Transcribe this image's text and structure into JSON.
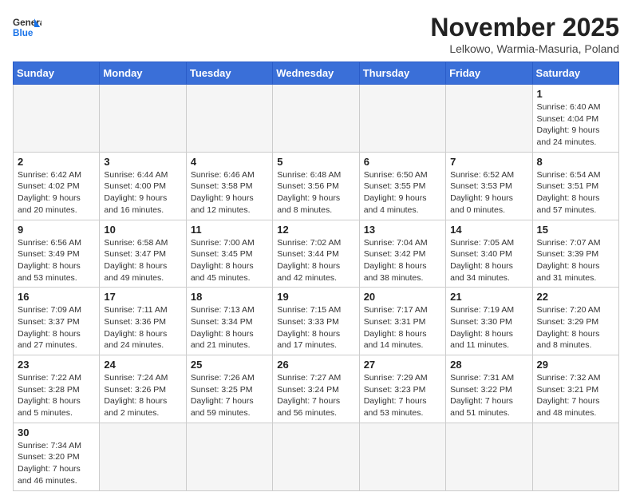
{
  "header": {
    "logo_general": "General",
    "logo_blue": "Blue",
    "month_title": "November 2025",
    "subtitle": "Lelkowo, Warmia-Masuria, Poland"
  },
  "weekdays": [
    "Sunday",
    "Monday",
    "Tuesday",
    "Wednesday",
    "Thursday",
    "Friday",
    "Saturday"
  ],
  "days": {
    "1": {
      "sunrise": "6:40 AM",
      "sunset": "4:04 PM",
      "daylight": "9 hours and 24 minutes."
    },
    "2": {
      "sunrise": "6:42 AM",
      "sunset": "4:02 PM",
      "daylight": "9 hours and 20 minutes."
    },
    "3": {
      "sunrise": "6:44 AM",
      "sunset": "4:00 PM",
      "daylight": "9 hours and 16 minutes."
    },
    "4": {
      "sunrise": "6:46 AM",
      "sunset": "3:58 PM",
      "daylight": "9 hours and 12 minutes."
    },
    "5": {
      "sunrise": "6:48 AM",
      "sunset": "3:56 PM",
      "daylight": "9 hours and 8 minutes."
    },
    "6": {
      "sunrise": "6:50 AM",
      "sunset": "3:55 PM",
      "daylight": "9 hours and 4 minutes."
    },
    "7": {
      "sunrise": "6:52 AM",
      "sunset": "3:53 PM",
      "daylight": "9 hours and 0 minutes."
    },
    "8": {
      "sunrise": "6:54 AM",
      "sunset": "3:51 PM",
      "daylight": "8 hours and 57 minutes."
    },
    "9": {
      "sunrise": "6:56 AM",
      "sunset": "3:49 PM",
      "daylight": "8 hours and 53 minutes."
    },
    "10": {
      "sunrise": "6:58 AM",
      "sunset": "3:47 PM",
      "daylight": "8 hours and 49 minutes."
    },
    "11": {
      "sunrise": "7:00 AM",
      "sunset": "3:45 PM",
      "daylight": "8 hours and 45 minutes."
    },
    "12": {
      "sunrise": "7:02 AM",
      "sunset": "3:44 PM",
      "daylight": "8 hours and 42 minutes."
    },
    "13": {
      "sunrise": "7:04 AM",
      "sunset": "3:42 PM",
      "daylight": "8 hours and 38 minutes."
    },
    "14": {
      "sunrise": "7:05 AM",
      "sunset": "3:40 PM",
      "daylight": "8 hours and 34 minutes."
    },
    "15": {
      "sunrise": "7:07 AM",
      "sunset": "3:39 PM",
      "daylight": "8 hours and 31 minutes."
    },
    "16": {
      "sunrise": "7:09 AM",
      "sunset": "3:37 PM",
      "daylight": "8 hours and 27 minutes."
    },
    "17": {
      "sunrise": "7:11 AM",
      "sunset": "3:36 PM",
      "daylight": "8 hours and 24 minutes."
    },
    "18": {
      "sunrise": "7:13 AM",
      "sunset": "3:34 PM",
      "daylight": "8 hours and 21 minutes."
    },
    "19": {
      "sunrise": "7:15 AM",
      "sunset": "3:33 PM",
      "daylight": "8 hours and 17 minutes."
    },
    "20": {
      "sunrise": "7:17 AM",
      "sunset": "3:31 PM",
      "daylight": "8 hours and 14 minutes."
    },
    "21": {
      "sunrise": "7:19 AM",
      "sunset": "3:30 PM",
      "daylight": "8 hours and 11 minutes."
    },
    "22": {
      "sunrise": "7:20 AM",
      "sunset": "3:29 PM",
      "daylight": "8 hours and 8 minutes."
    },
    "23": {
      "sunrise": "7:22 AM",
      "sunset": "3:28 PM",
      "daylight": "8 hours and 5 minutes."
    },
    "24": {
      "sunrise": "7:24 AM",
      "sunset": "3:26 PM",
      "daylight": "8 hours and 2 minutes."
    },
    "25": {
      "sunrise": "7:26 AM",
      "sunset": "3:25 PM",
      "daylight": "7 hours and 59 minutes."
    },
    "26": {
      "sunrise": "7:27 AM",
      "sunset": "3:24 PM",
      "daylight": "7 hours and 56 minutes."
    },
    "27": {
      "sunrise": "7:29 AM",
      "sunset": "3:23 PM",
      "daylight": "7 hours and 53 minutes."
    },
    "28": {
      "sunrise": "7:31 AM",
      "sunset": "3:22 PM",
      "daylight": "7 hours and 51 minutes."
    },
    "29": {
      "sunrise": "7:32 AM",
      "sunset": "3:21 PM",
      "daylight": "7 hours and 48 minutes."
    },
    "30": {
      "sunrise": "7:34 AM",
      "sunset": "3:20 PM",
      "daylight": "7 hours and 46 minutes."
    }
  }
}
